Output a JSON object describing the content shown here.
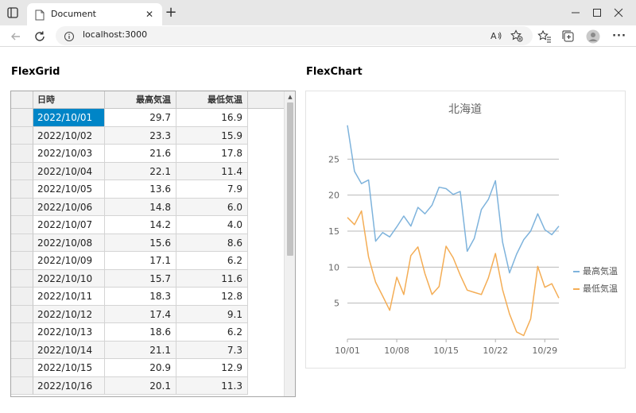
{
  "browser": {
    "tab_title": "Document",
    "tab_close": "✕",
    "new_tab": "+",
    "url": "localhost:3000",
    "more_menu": "···"
  },
  "grid": {
    "title": "FlexGrid",
    "columns": [
      "日時",
      "最高気温",
      "最低気温"
    ],
    "rows": [
      [
        "2022/10/01",
        "29.7",
        "16.9"
      ],
      [
        "2022/10/02",
        "23.3",
        "15.9"
      ],
      [
        "2022/10/03",
        "21.6",
        "17.8"
      ],
      [
        "2022/10/04",
        "22.1",
        "11.4"
      ],
      [
        "2022/10/05",
        "13.6",
        "7.9"
      ],
      [
        "2022/10/06",
        "14.8",
        "6.0"
      ],
      [
        "2022/10/07",
        "14.2",
        "4.0"
      ],
      [
        "2022/10/08",
        "15.6",
        "8.6"
      ],
      [
        "2022/10/09",
        "17.1",
        "6.2"
      ],
      [
        "2022/10/10",
        "15.7",
        "11.6"
      ],
      [
        "2022/10/11",
        "18.3",
        "12.8"
      ],
      [
        "2022/10/12",
        "17.4",
        "9.1"
      ],
      [
        "2022/10/13",
        "18.6",
        "6.2"
      ],
      [
        "2022/10/14",
        "21.1",
        "7.3"
      ],
      [
        "2022/10/15",
        "20.9",
        "12.9"
      ],
      [
        "2022/10/16",
        "20.1",
        "11.3"
      ]
    ],
    "selected_cell": "2022/10/01",
    "scroll_up": "▲",
    "colors": {
      "selection": "#0085c7",
      "header_bg": "#f0f0f0",
      "alt_row": "#f5f5f5"
    }
  },
  "chart": {
    "title": "FlexChart"
  },
  "chart_data": {
    "type": "line",
    "title": "北海道",
    "xlabel": "",
    "ylabel": "",
    "x_tick_labels": [
      "10/01",
      "10/08",
      "10/15",
      "10/22",
      "10/29"
    ],
    "y_ticks": [
      5,
      10,
      15,
      20,
      25
    ],
    "ylim": [
      0,
      30
    ],
    "x_dates": [
      "10/01",
      "10/02",
      "10/03",
      "10/04",
      "10/05",
      "10/06",
      "10/07",
      "10/08",
      "10/09",
      "10/10",
      "10/11",
      "10/12",
      "10/13",
      "10/14",
      "10/15",
      "10/16",
      "10/17",
      "10/18",
      "10/19",
      "10/20",
      "10/21",
      "10/22",
      "10/23",
      "10/24",
      "10/25",
      "10/26",
      "10/27",
      "10/28",
      "10/29",
      "10/30",
      "10/31"
    ],
    "grid": true,
    "legend_position": "right",
    "series": [
      {
        "name": "最高気温",
        "color": "#7eb3dc",
        "values": [
          29.7,
          23.3,
          21.6,
          22.1,
          13.6,
          14.8,
          14.2,
          15.6,
          17.1,
          15.7,
          18.3,
          17.4,
          18.6,
          21.1,
          20.9,
          20.1,
          20.5,
          12.2,
          14.0,
          18.0,
          19.4,
          22.0,
          13.5,
          9.2,
          11.8,
          13.8,
          15.0,
          17.4,
          15.2,
          14.5,
          15.7
        ]
      },
      {
        "name": "最低気温",
        "color": "#f4ad55",
        "values": [
          16.9,
          15.9,
          17.8,
          11.4,
          7.9,
          6.0,
          4.0,
          8.6,
          6.2,
          11.6,
          12.8,
          9.1,
          6.2,
          7.3,
          12.9,
          11.3,
          8.9,
          6.8,
          6.5,
          6.2,
          8.5,
          11.9,
          6.9,
          3.5,
          1.0,
          0.5,
          2.8,
          10.1,
          7.2,
          7.7,
          5.7
        ]
      }
    ]
  }
}
